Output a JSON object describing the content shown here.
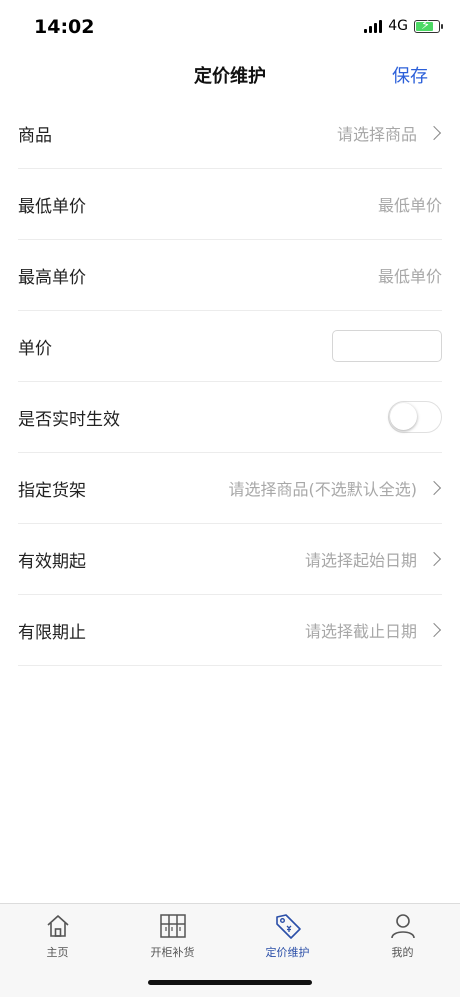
{
  "status": {
    "time": "14:02",
    "network": "4G"
  },
  "nav": {
    "title": "定价维护",
    "save_label": "保存"
  },
  "form": {
    "product": {
      "label": "商品",
      "placeholder": "请选择商品"
    },
    "min_price": {
      "label": "最低单价",
      "placeholder": "最低单价"
    },
    "max_price": {
      "label": "最高单价",
      "placeholder": "最低单价"
    },
    "unit_price": {
      "label": "单价",
      "value": ""
    },
    "realtime": {
      "label": "是否实时生效",
      "on": false
    },
    "shelf": {
      "label": "指定货架",
      "placeholder": "请选择商品(不选默认全选)"
    },
    "start_date": {
      "label": "有效期起",
      "placeholder": "请选择起始日期"
    },
    "end_date": {
      "label": "有限期止",
      "placeholder": "请选择截止日期"
    }
  },
  "tabs": [
    {
      "label": "主页",
      "icon": "home-icon",
      "active": false
    },
    {
      "label": "开柜补货",
      "icon": "cabinet-icon",
      "active": false
    },
    {
      "label": "定价维护",
      "icon": "price-tag-icon",
      "active": true
    },
    {
      "label": "我的",
      "icon": "user-icon",
      "active": false
    }
  ],
  "colors": {
    "accent": "#2b5fd9",
    "tab_active": "#2b4fa8",
    "placeholder": "#a8a8a8"
  }
}
